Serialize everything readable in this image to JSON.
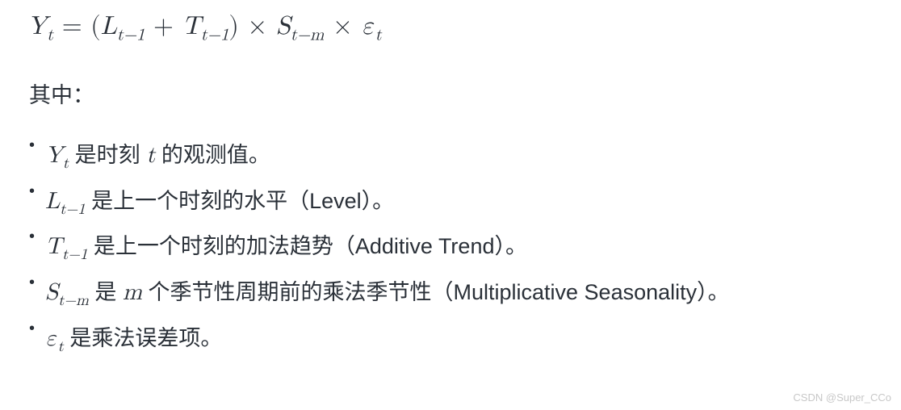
{
  "formula": {
    "lhs_var": "Y",
    "lhs_sub": "t",
    "eq": " = ",
    "lparen": "(",
    "L_var": "L",
    "L_sub": "t−1",
    "plus": " + ",
    "T_var": "T",
    "T_sub": "t−1",
    "rparen": ")",
    "times1": " × ",
    "S_var": "S",
    "S_sub": "t−m",
    "times2": " × ",
    "eps_var": "ε",
    "eps_sub": "t"
  },
  "intro": "其中：",
  "bullets": [
    {
      "pre": "",
      "sym_var": "Y",
      "sym_sub": "t",
      "mid": " 是时刻 ",
      "sym2_var": "t",
      "sym2_sub": "",
      "post": " 的观测值。"
    },
    {
      "pre": "",
      "sym_var": "L",
      "sym_sub": "t−1",
      "mid": " 是上一个时刻的水平（Level）。",
      "sym2_var": "",
      "sym2_sub": "",
      "post": ""
    },
    {
      "pre": "",
      "sym_var": "T",
      "sym_sub": "t−1",
      "mid": " 是上一个时刻的加法趋势（Additive Trend）。",
      "sym2_var": "",
      "sym2_sub": "",
      "post": ""
    },
    {
      "pre": "",
      "sym_var": "S",
      "sym_sub": "t−m",
      "mid": " 是 ",
      "sym2_var": "m",
      "sym2_sub": "",
      "post": " 个季节性周期前的乘法季节性（Multiplicative Seasonality）。"
    },
    {
      "pre": "",
      "sym_var": "ε",
      "sym_sub": "t",
      "mid": " 是乘法误差项。",
      "sym2_var": "",
      "sym2_sub": "",
      "post": ""
    }
  ],
  "watermark": "CSDN @Super_CCo"
}
